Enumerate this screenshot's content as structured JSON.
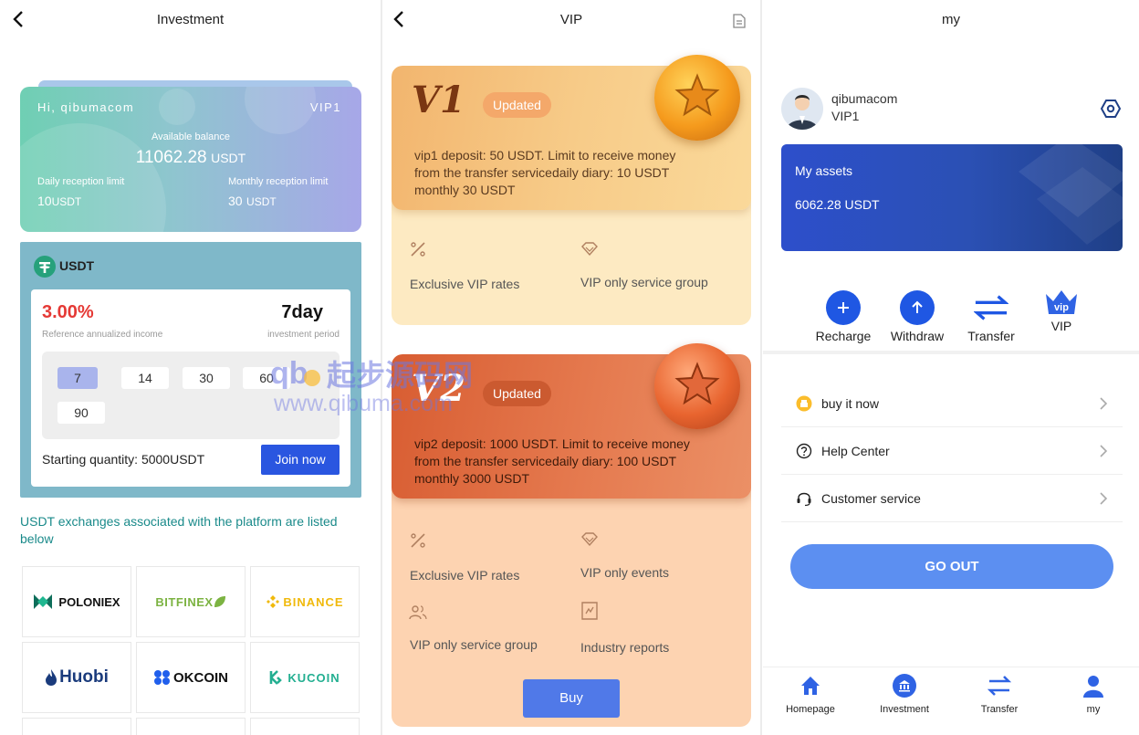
{
  "investment": {
    "title": "Investment",
    "card": {
      "greeting": "Hi, qibumacom",
      "vip": "VIP1",
      "balance_label": "Available balance",
      "balance_value": "11062.28",
      "balance_unit": "USDT",
      "daily_label": "Daily reception limit",
      "daily_value": "10",
      "daily_unit": "USDT",
      "monthly_label": "Monthly reception limit",
      "monthly_value": "30",
      "monthly_unit": "USDT"
    },
    "product": {
      "name": "USDT",
      "rate": "3.00%",
      "rate_label": "Reference annualized income",
      "period": "7day",
      "period_label": "investment period",
      "day_options": [
        "7",
        "14",
        "30",
        "60",
        "90"
      ],
      "selected_day": "7",
      "starting_quantity": "Starting quantity:  5000USDT",
      "join_label": "Join now"
    },
    "exchanges_caption": "USDT exchanges associated with the platform are listed below",
    "exchanges": [
      "POLONIEX",
      "BITFINEX",
      "BINANCE",
      "Huobi",
      "OKCOIN",
      "KUCOIN"
    ]
  },
  "vip": {
    "title": "VIP",
    "tiers": [
      {
        "name": "V1",
        "badge": "Updated",
        "desc_line1": "vip1 deposit:  50 USDT. Limit to receive money",
        "desc_line2": "from the transfer servicedaily diary:  10 USDT",
        "desc_line3": "monthly 30 USDT",
        "features": [
          "Exclusive VIP rates",
          "VIP only service group"
        ]
      },
      {
        "name": "V2",
        "badge": "Updated",
        "desc_line1": "vip2 deposit:  1000 USDT. Limit to receive money",
        "desc_line2": "from the transfer servicedaily diary:  100 USDT",
        "desc_line3": "monthly 3000 USDT",
        "features": [
          "Exclusive VIP rates",
          "VIP only events",
          "VIP only service group",
          "Industry reports"
        ]
      }
    ],
    "buy_label": "Buy"
  },
  "my": {
    "title": "my",
    "username": "qibumacom",
    "level": "VIP1",
    "assets_label": "My assets",
    "assets_value": "6062.28 USDT",
    "actions": [
      "Recharge",
      "Withdraw",
      "Transfer",
      "VIP"
    ],
    "menu": [
      "buy it now",
      "Help Center",
      "Customer service"
    ],
    "goout_label": "GO OUT",
    "tabs": [
      "Homepage",
      "Investment",
      "Transfer",
      "my"
    ]
  },
  "watermark": {
    "cn": "起步源码网",
    "url": "www.qibuma.com"
  },
  "colors": {
    "accent": "#2a56e0",
    "rate_red": "#e53935",
    "usdt_green": "#26a17b",
    "assets_blue": "#2d4fcb"
  }
}
